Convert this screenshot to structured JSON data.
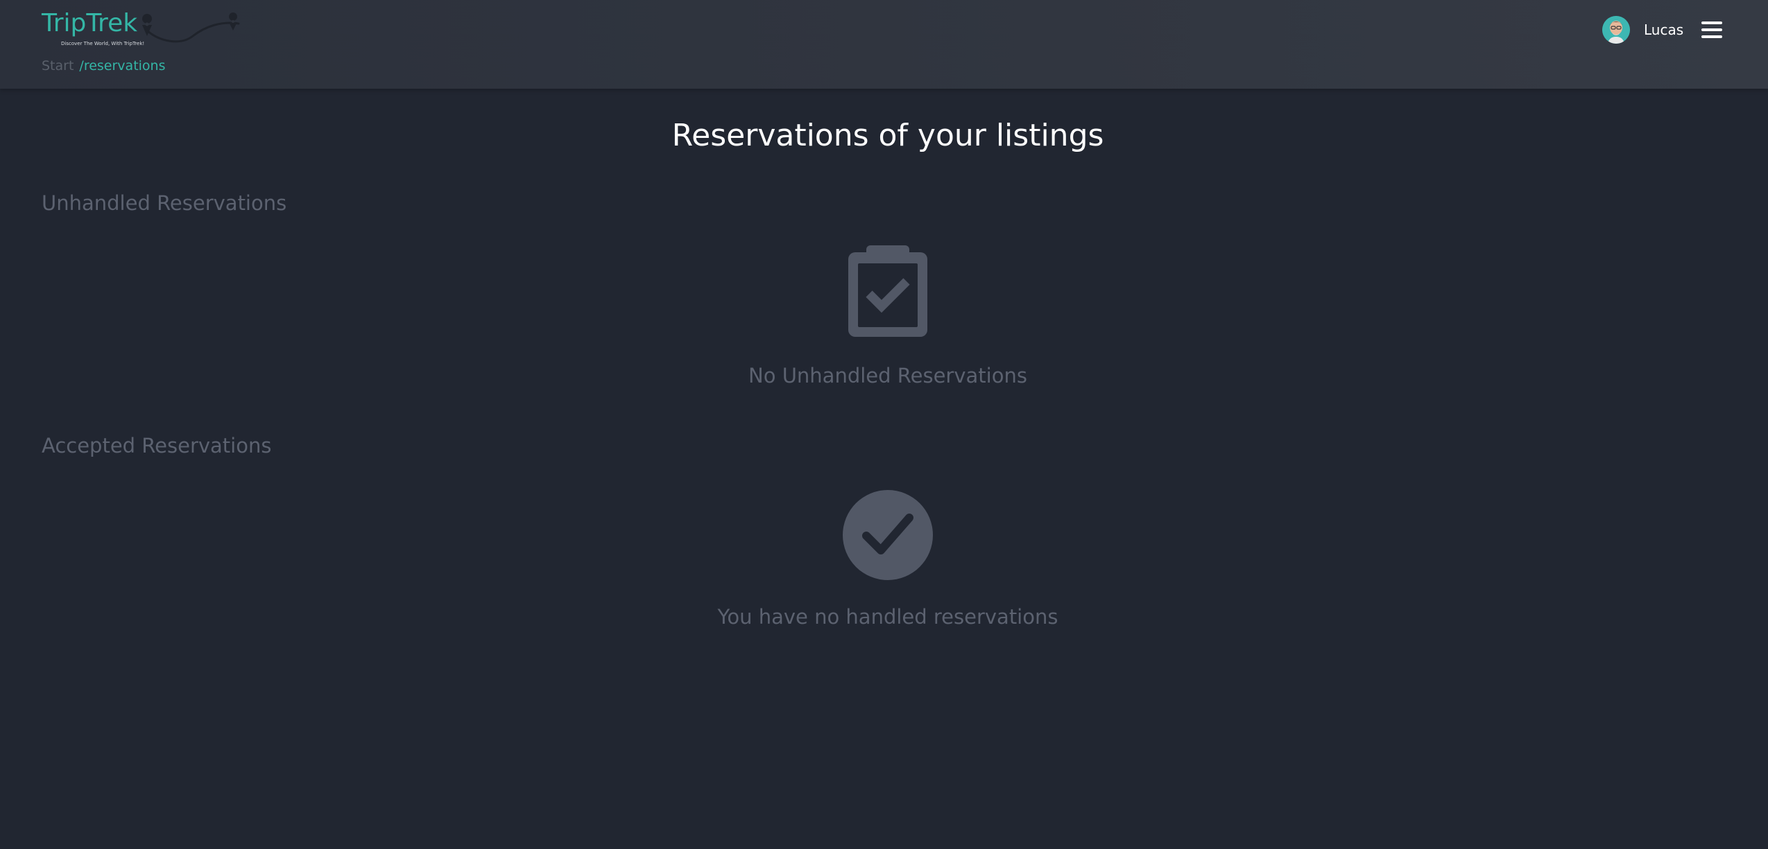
{
  "header": {
    "logo": {
      "name": "TripTrek",
      "tagline": "Discover The World, With TripTrek!",
      "brand_color": "#34b6a6"
    },
    "breadcrumb": {
      "start": "Start",
      "current": "/reservations"
    },
    "user": {
      "name": "Lucas",
      "avatar_icon": "user-avatar"
    },
    "menu_icon": "hamburger-menu-icon"
  },
  "main": {
    "title": "Reservations of your listings",
    "sections": [
      {
        "title": "Unhandled Reservations",
        "empty_icon": "clipboard-check-icon",
        "empty_message": "No Unhandled Reservations"
      },
      {
        "title": "Accepted Reservations",
        "empty_icon": "circle-check-icon",
        "empty_message": "You have no handled reservations"
      }
    ]
  },
  "colors": {
    "background": "#212631",
    "header": "#2f343e",
    "muted": "#5c6270",
    "icon": "#525866"
  }
}
